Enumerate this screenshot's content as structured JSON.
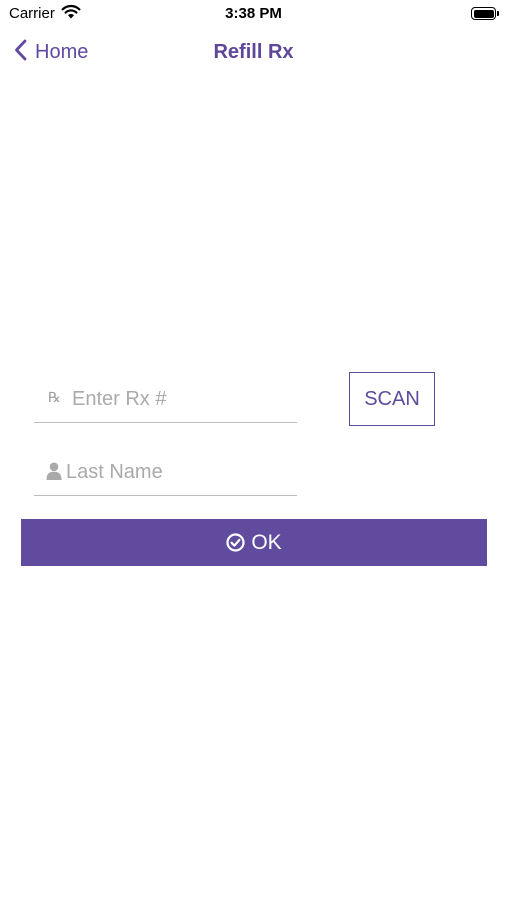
{
  "status_bar": {
    "carrier": "Carrier",
    "time": "3:38 PM",
    "wifi_icon": "wifi-icon",
    "battery_icon": "battery-full-icon"
  },
  "nav": {
    "back_label": "Home",
    "back_icon": "chevron-left-icon",
    "title": "Refill Rx"
  },
  "form": {
    "rx_icon_glyph": "℞",
    "rx_placeholder": "Enter Rx #",
    "rx_value": "",
    "scan_label": "SCAN",
    "name_icon": "person-icon",
    "name_placeholder": "Last Name",
    "name_value": "",
    "ok_label": "OK",
    "ok_icon": "check-circle-icon"
  },
  "colors": {
    "accent": "#614b9e",
    "field_underline": "#bdbdbd",
    "placeholder": "#aaaaaa"
  }
}
